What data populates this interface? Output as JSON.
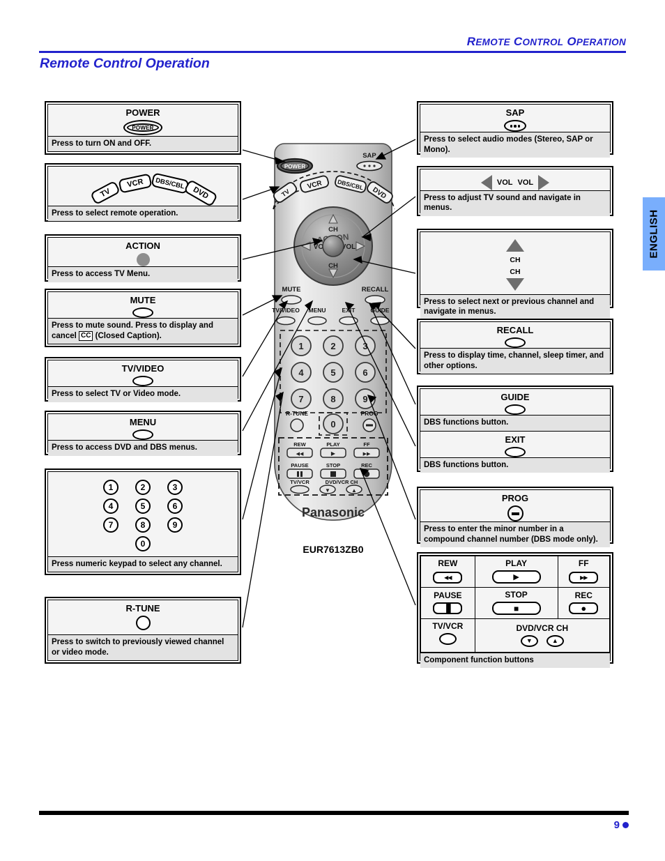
{
  "header": {
    "running_head": "REMOTE CONTROL OPERATION",
    "page_title": "Remote Control Operation"
  },
  "side_tab": {
    "label": "ENGLISH"
  },
  "footer": {
    "page_number": "9"
  },
  "remote": {
    "model": "EUR7613ZB0",
    "brand": "Panasonic",
    "labels": {
      "power": "POWER",
      "sap": "SAP",
      "tv": "TV",
      "vcr": "VCR",
      "dbs_cbl": "DBS/CBL",
      "dvd": "DVD",
      "action": "ACTION",
      "ch_up": "CH",
      "ch_down": "CH",
      "vol_left": "VOL",
      "vol_right": "VOL",
      "mute": "MUTE",
      "recall": "RECALL",
      "tv_video": "TV/VIDEO",
      "menu": "MENU",
      "exit": "EXIT",
      "guide": "GUIDE",
      "r_tune": "R-TUNE",
      "prog": "PROG",
      "rew": "REW",
      "play": "PLAY",
      "ff": "FF",
      "pause": "PAUSE",
      "stop": "STOP",
      "rec": "REC",
      "tv_vcr": "TV/VCR",
      "dvd_vcr_ch": "DVD/VCR CH"
    },
    "keypad": [
      "1",
      "2",
      "3",
      "4",
      "5",
      "6",
      "7",
      "8",
      "9",
      "0"
    ]
  },
  "left_boxes": [
    {
      "title": "POWER",
      "glyph": "power-oval-button",
      "caption": "Press to turn ON and OFF."
    },
    {
      "title": "",
      "glyph": "mode-select-buttons",
      "modes": [
        "TV",
        "VCR",
        "DBS/CBL",
        "DVD"
      ],
      "caption": "Press to select remote operation."
    },
    {
      "title": "ACTION",
      "glyph": "filled-circle-button",
      "caption": "Press to access TV Menu."
    },
    {
      "title": "MUTE",
      "glyph": "oval-button",
      "caption_part1": "Press to mute sound. Press to display and cancel",
      "caption_cc": "CC",
      "caption_part2": "(Closed Caption)."
    },
    {
      "title": "TV/VIDEO",
      "glyph": "oval-button",
      "caption": "Press to select TV or Video mode."
    },
    {
      "title": "MENU",
      "glyph": "oval-button",
      "caption": "Press to access DVD and DBS menus."
    },
    {
      "title": "",
      "glyph": "numeric-keypad",
      "keys": [
        "1",
        "2",
        "3",
        "4",
        "5",
        "6",
        "7",
        "8",
        "9",
        "0"
      ],
      "caption": "Press numeric keypad to select any channel."
    },
    {
      "title": "R-TUNE",
      "glyph": "circle-button",
      "caption": "Press to switch to previously viewed channel or video mode."
    }
  ],
  "right_boxes": [
    {
      "title": "SAP",
      "glyph": "sap-three-dot-button",
      "caption": "Press to select audio modes (Stereo, SAP or Mono)."
    },
    {
      "title": "",
      "glyph": "volume-left-right-arrows",
      "vol_left_label": "VOL",
      "vol_right_label": "VOL",
      "caption": "Press to adjust TV sound and navigate in menus."
    },
    {
      "title": "",
      "glyph": "channel-up-down-arrows",
      "ch_up_label": "CH",
      "ch_down_label": "CH",
      "caption": "Press to select next or previous channel and navigate in menus."
    },
    {
      "title": "RECALL",
      "glyph": "oval-button",
      "caption": "Press to display time, channel, sleep timer, and other options."
    },
    {
      "title": "GUIDE",
      "glyph": "oval-button",
      "caption": "DBS functions button."
    },
    {
      "title": "EXIT",
      "glyph": "oval-button",
      "caption": "DBS functions button."
    },
    {
      "title": "PROG",
      "glyph": "prog-minus-button",
      "caption": "Press to enter the minor number in a compound channel number (DBS mode only)."
    }
  ],
  "component_table": {
    "rows": [
      [
        {
          "label": "REW",
          "glyph": "rewind-icon"
        },
        {
          "label": "PLAY",
          "glyph": "play-icon"
        },
        {
          "label": "FF",
          "glyph": "fast-forward-icon"
        }
      ],
      [
        {
          "label": "PAUSE",
          "glyph": "pause-icon"
        },
        {
          "label": "STOP",
          "glyph": "stop-icon"
        },
        {
          "label": "REC",
          "glyph": "record-icon"
        }
      ],
      [
        {
          "label": "TV/VCR",
          "glyph": "oval-icon"
        },
        {
          "label": "DVD/VCR CH",
          "glyph": "channel-down-up-icons"
        }
      ]
    ],
    "caption": "Component function buttons"
  },
  "colors": {
    "accent_blue": "#2222cc",
    "tab_blue": "#79aefc",
    "caption_grey": "#e3e3e3",
    "art_grey": "#f4f4f4"
  }
}
